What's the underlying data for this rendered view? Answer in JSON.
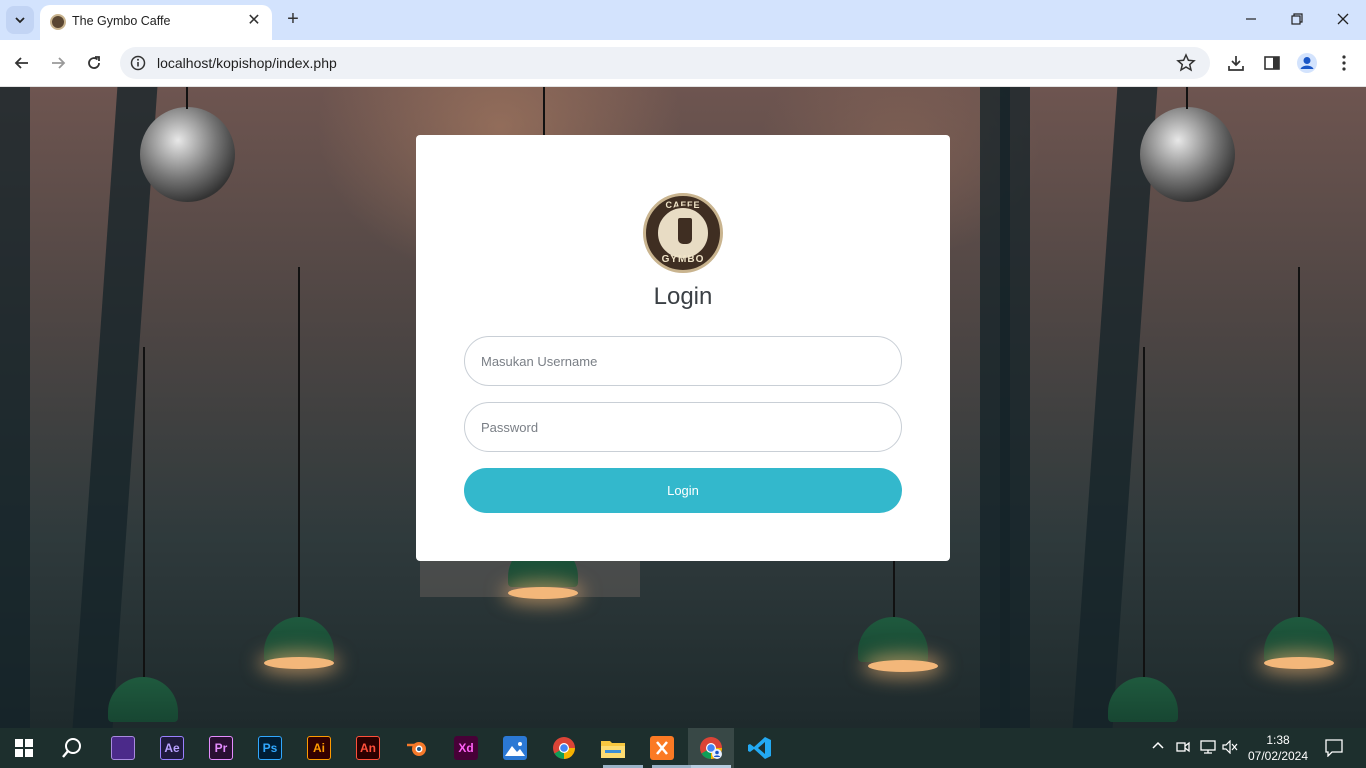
{
  "browser": {
    "tab_title": "The Gymbo Caffe",
    "url": "localhost/kopishop/index.php",
    "new_tab_symbol": "+",
    "close_symbol": "✕"
  },
  "login": {
    "logo_top_text": "CAFFE",
    "logo_bottom_text": "GYMBO",
    "title": "Login",
    "username_placeholder": "Masukan Username",
    "password_placeholder": "Password",
    "button_label": "Login",
    "button_color": "#33b8cc"
  },
  "taskbar": {
    "apps": [
      {
        "name": "windows-start",
        "label": ""
      },
      {
        "name": "search",
        "label": ""
      },
      {
        "name": "kdenlive",
        "label": ""
      },
      {
        "name": "after-effects",
        "label": "Ae"
      },
      {
        "name": "premiere",
        "label": "Pr"
      },
      {
        "name": "photoshop",
        "label": "Ps"
      },
      {
        "name": "illustrator",
        "label": "Ai"
      },
      {
        "name": "animate",
        "label": "An"
      },
      {
        "name": "blender",
        "label": ""
      },
      {
        "name": "xd",
        "label": "Xd"
      },
      {
        "name": "photos",
        "label": ""
      },
      {
        "name": "chrome",
        "label": ""
      },
      {
        "name": "file-explorer",
        "label": ""
      },
      {
        "name": "xampp",
        "label": ""
      },
      {
        "name": "chrome-profile",
        "label": ""
      },
      {
        "name": "vscode",
        "label": ""
      }
    ],
    "time": "1:38",
    "date": "07/02/2024"
  }
}
